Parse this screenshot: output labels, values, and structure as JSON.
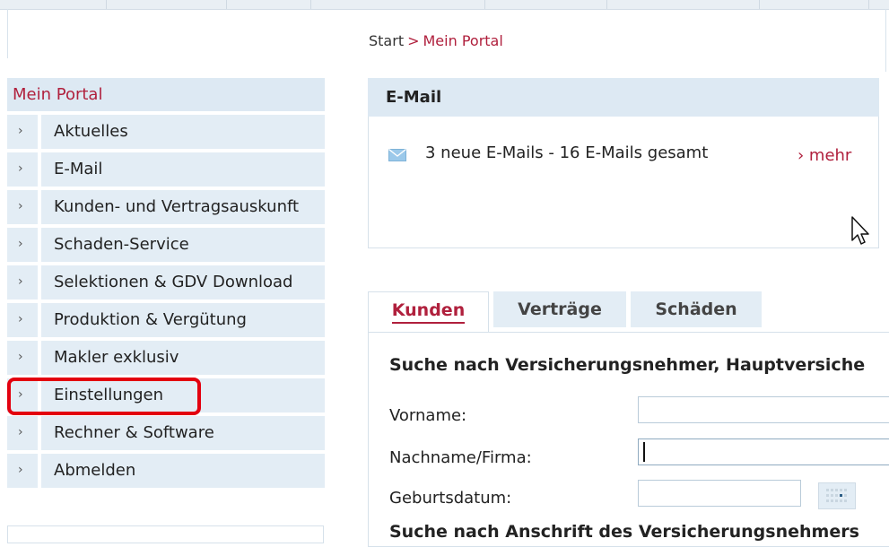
{
  "breadcrumb": {
    "home": "Start",
    "separator": ">",
    "current": "Mein Portal"
  },
  "sidebar": {
    "title": "Mein Portal",
    "items": [
      {
        "label": "Aktuelles"
      },
      {
        "label": "E-Mail"
      },
      {
        "label": "Kunden- und Vertragsauskunft"
      },
      {
        "label": "Schaden-Service"
      },
      {
        "label": "Selektionen & GDV Download"
      },
      {
        "label": "Produktion & Vergütung"
      },
      {
        "label": "Makler exklusiv"
      },
      {
        "label": "Einstellungen",
        "highlighted": true
      },
      {
        "label": "Rechner & Software"
      },
      {
        "label": "Abmelden"
      }
    ]
  },
  "email": {
    "title": "E-Mail",
    "summary": "3 neue E-Mails - 16 E-Mails gesamt",
    "more_link": "› mehr",
    "icon": "envelope-icon"
  },
  "tabs": [
    {
      "label": "Kunden",
      "active": true
    },
    {
      "label": "Verträge",
      "active": false
    },
    {
      "label": "Schäden",
      "active": false
    }
  ],
  "search": {
    "heading": "Suche nach Versicherungsnehmer, Hauptversiche",
    "fields": {
      "first_name": {
        "label": "Vorname:",
        "value": ""
      },
      "last_name": {
        "label": "Nachname/Firma:",
        "value": ""
      },
      "birth_date": {
        "label": "Geburtsdatum:",
        "value": ""
      }
    },
    "heading2": "Suche nach Anschrift des Versicherungsnehmers"
  },
  "colors": {
    "accent": "#b0203d",
    "panel": "#dde9f3",
    "highlight": "#e3000f"
  }
}
